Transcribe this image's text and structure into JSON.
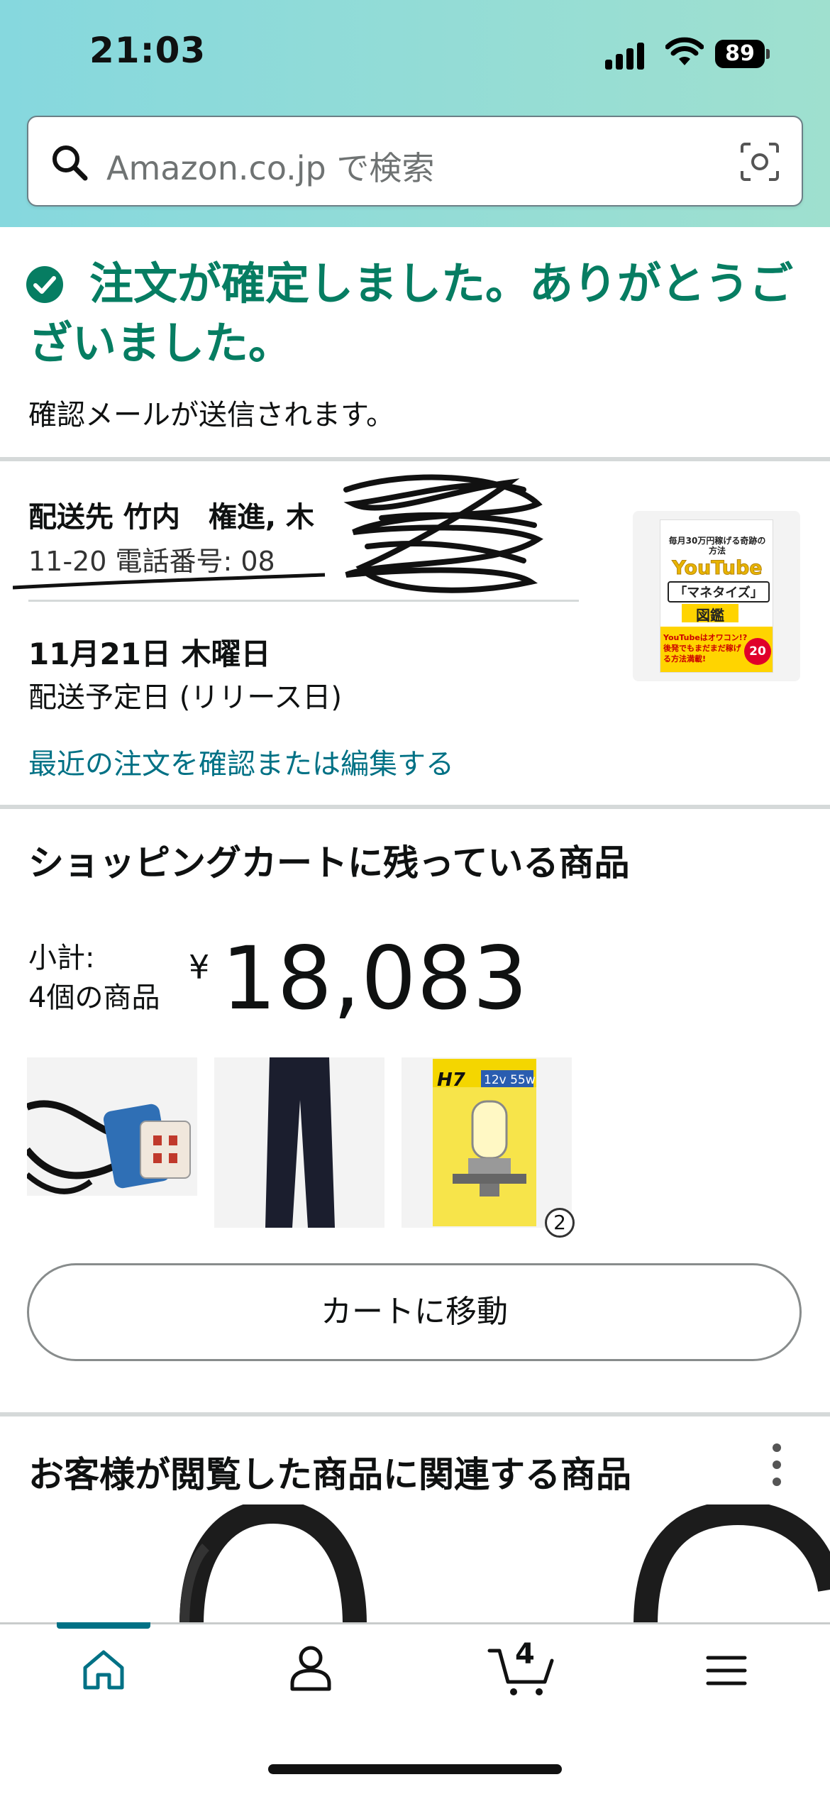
{
  "status_bar": {
    "time": "21:03",
    "battery": "89"
  },
  "search": {
    "placeholder": "Amazon.co.jp で検索"
  },
  "confirmation": {
    "title": "注文が確定しました。ありがとうございました。",
    "subtitle": "確認メールが送信されます。"
  },
  "shipping": {
    "address_line1": "配送先 竹内　権進, 木",
    "address_line2": "11-20  電話番号: 08",
    "delivery_date": "11月21日 木曜日",
    "delivery_note": "配送予定日 (リリース日)",
    "recent_orders_link": "最近の注文を確認または編集する",
    "book_cover": {
      "line1": "毎月30万円稼げる奇跡の方法",
      "brand": "YouTube",
      "title": "「マネタイズ」",
      "subtitle": "図鑑",
      "tagline": "YouTubeはオワコン!? 後発でもまだまだ稼げる方法満載!",
      "badge": "20"
    }
  },
  "cart": {
    "heading": "ショッピングカートに残っている商品",
    "subtotal_label": "小計:",
    "item_count_label": "4個の商品",
    "currency": "¥",
    "subtotal_amount": "18,083",
    "items": [
      {
        "name": "connector-cable",
        "quantity": null
      },
      {
        "name": "black-pants",
        "quantity": null
      },
      {
        "name": "h7-bulb",
        "package_text": "H7",
        "spec": "12v 55w",
        "quantity": "2"
      }
    ],
    "go_to_cart_label": "カートに移動"
  },
  "related": {
    "heading": "お客様が閲覧した商品に関連する商品"
  },
  "bottom_nav": {
    "items": [
      {
        "icon": "home-icon",
        "active": true
      },
      {
        "icon": "account-icon",
        "active": false
      },
      {
        "icon": "cart-icon",
        "active": false
      },
      {
        "icon": "menu-icon",
        "active": false
      }
    ],
    "cart_count": "4"
  },
  "colors": {
    "accent_teal": "#007185",
    "success_green": "#067d62",
    "header_gradient_start": "#86d8de",
    "header_gradient_end": "#9fe0cf"
  }
}
